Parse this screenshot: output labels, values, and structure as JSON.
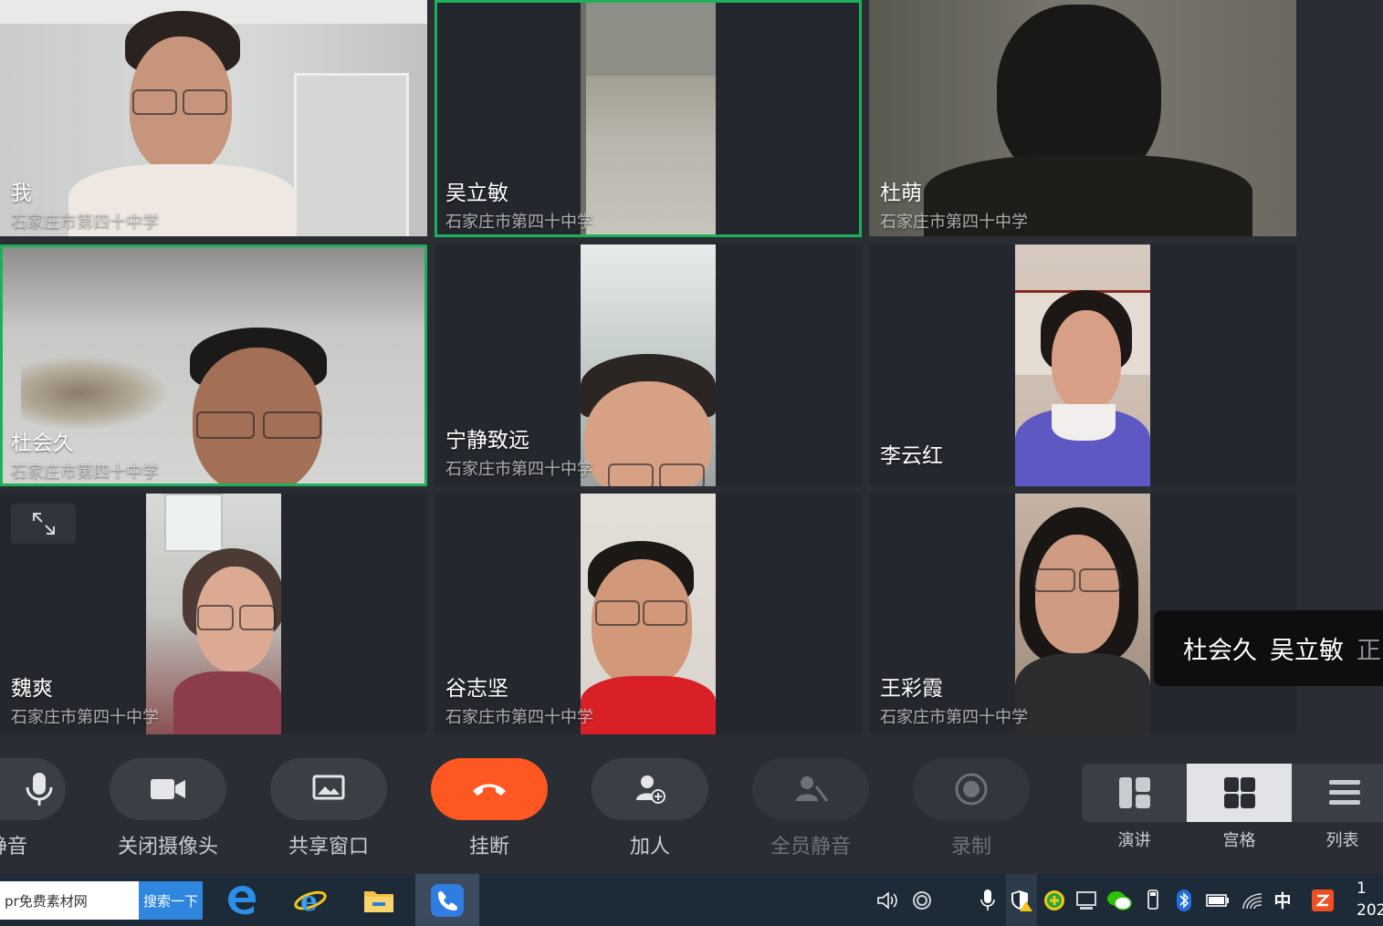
{
  "participants": {
    "p1": {
      "name": "我",
      "org": "石家庄市第四十中学"
    },
    "p2": {
      "name": "吴立敏",
      "org": "石家庄市第四十中学"
    },
    "p3": {
      "name": "杜萌",
      "org": "石家庄市第四十中学"
    },
    "p4": {
      "name": "杜会久",
      "org": "石家庄市第四十中学"
    },
    "p5": {
      "name": "宁静致远",
      "org": "石家庄市第四十中学"
    },
    "p6": {
      "name": "李云红"
    },
    "p7": {
      "name": "魏爽",
      "org": "石家庄市第四十中学"
    },
    "p8": {
      "name": "谷志坚",
      "org": "石家庄市第四十中学"
    },
    "p9": {
      "name": "王彩霞",
      "org": "石家庄市第四十中学"
    }
  },
  "tooltip": {
    "speaker1": "杜会久",
    "speaker2": "吴立敏",
    "more": "正"
  },
  "toolbar": {
    "mute": "静音",
    "camera": "关闭摄像头",
    "share": "共享窗口",
    "hangup": "挂断",
    "invite": "加人",
    "mute_all": "全员静音",
    "record": "录制"
  },
  "view": {
    "speaker": "演讲",
    "grid": "宫格",
    "list": "列表",
    "active": "grid"
  },
  "taskbar": {
    "search_text": "pr免费素材网",
    "search_button": "搜索一下",
    "ime": "中",
    "clock_line1": "1",
    "clock_line2": "202"
  },
  "colors": {
    "accent_speaking": "#1cb05b",
    "hangup": "#ff5722",
    "taskbar": "#1d2a38"
  }
}
